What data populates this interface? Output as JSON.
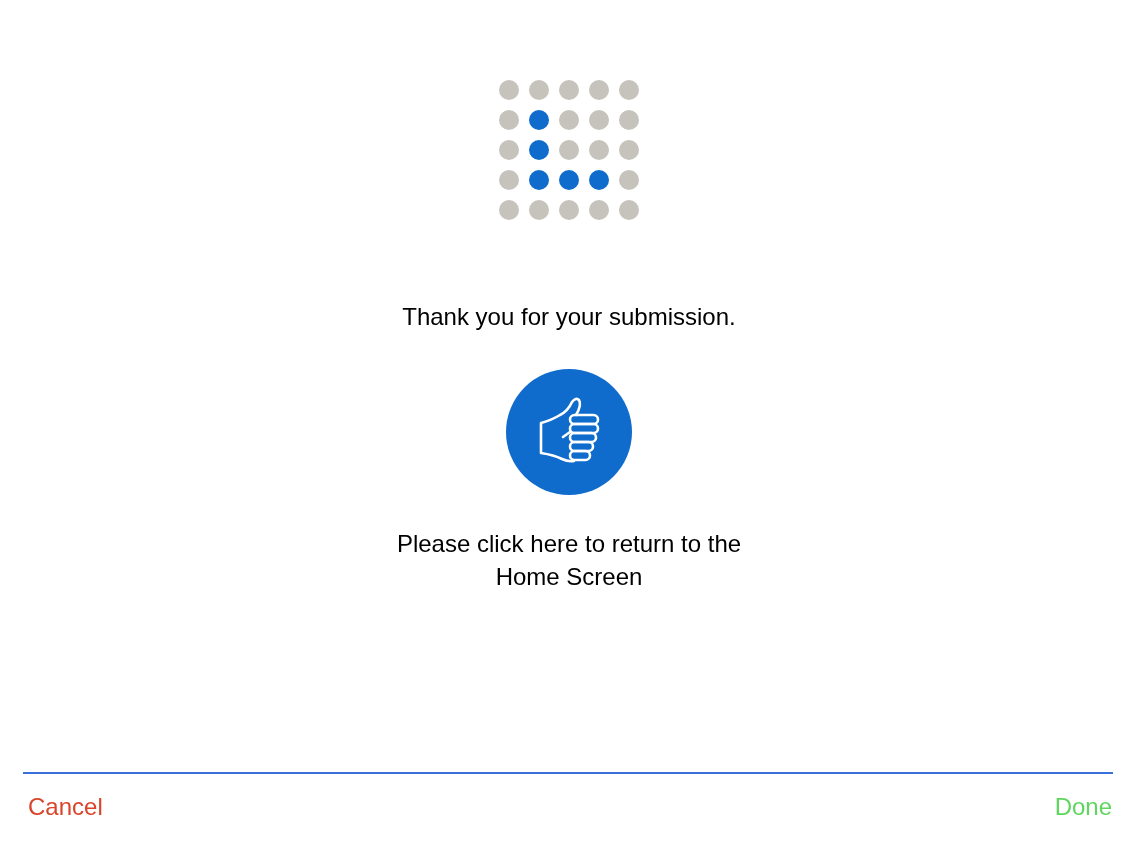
{
  "confirmation": {
    "message": "Thank you for your submission.",
    "return_link": "Please click here to return to the Home Screen"
  },
  "footer": {
    "buttons": [
      {
        "kind": "cancel",
        "label": "Cancel",
        "color": "#d9442b"
      },
      {
        "kind": "done",
        "label": "Done",
        "color": "#5fd65f"
      }
    ]
  }
}
